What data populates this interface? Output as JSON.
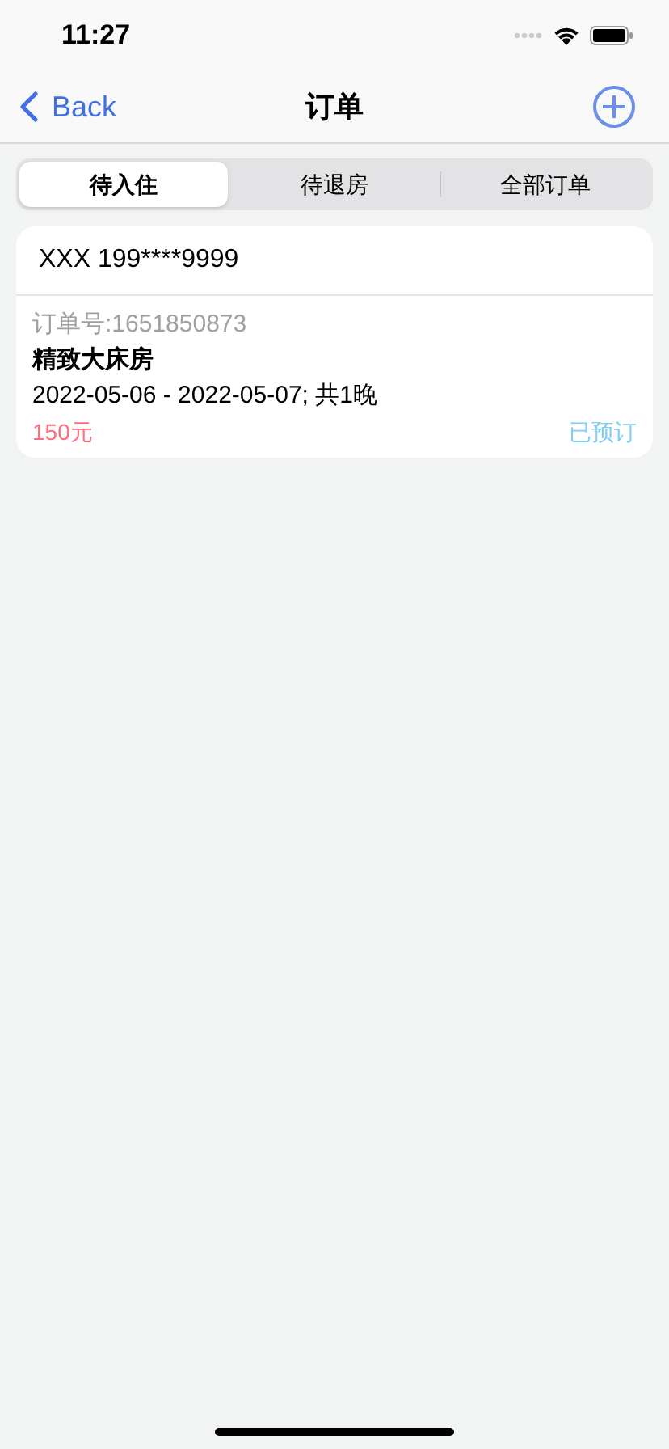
{
  "status_bar": {
    "time": "11:27"
  },
  "nav_bar": {
    "back": "Back",
    "title": "订单"
  },
  "tabs": [
    {
      "label": "待入住",
      "selected": true
    },
    {
      "label": "待退房",
      "selected": false
    },
    {
      "label": "全部订单",
      "selected": false
    }
  ],
  "orders": [
    {
      "guest": "XXX 199****9999",
      "order_number": "订单号:1651850873",
      "room": "精致大床房",
      "dates": "2022-05-06 - 2022-05-07; 共1晚",
      "price": "150元",
      "status": "已预订"
    }
  ]
}
